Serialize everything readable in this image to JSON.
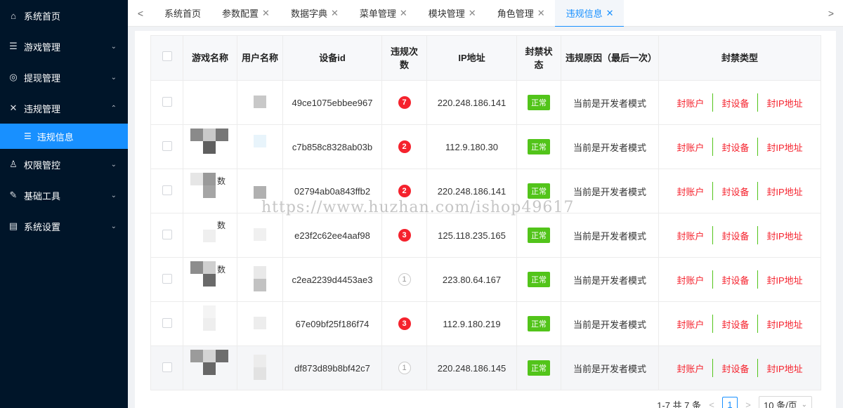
{
  "sidebar": {
    "items": [
      {
        "label": "系统首页",
        "icon": "home-icon",
        "glyph": "⌂",
        "has_children": false
      },
      {
        "label": "游戏管理",
        "icon": "list-icon",
        "glyph": "☰",
        "has_children": true,
        "chevron": "⌄"
      },
      {
        "label": "提现管理",
        "icon": "withdraw-icon",
        "glyph": "◎",
        "has_children": true,
        "chevron": "⌄"
      },
      {
        "label": "违规管理",
        "icon": "close-icon",
        "glyph": "✕",
        "has_children": true,
        "chevron": "⌃",
        "expanded": true
      },
      {
        "label": "权限管控",
        "icon": "user-icon",
        "glyph": "♙",
        "has_children": true,
        "chevron": "⌄"
      },
      {
        "label": "基础工具",
        "icon": "wrench-icon",
        "glyph": "✎",
        "has_children": true,
        "chevron": "⌄"
      },
      {
        "label": "系统设置",
        "icon": "settings-icon",
        "glyph": "▤",
        "has_children": true,
        "chevron": "⌄"
      }
    ],
    "sub_item": {
      "label": "违规信息",
      "icon": "list-icon",
      "glyph": "☰"
    }
  },
  "tabs": {
    "left_arrow": "<",
    "right_arrow": ">",
    "close_glyph": "✕",
    "items": [
      {
        "label": "系统首页",
        "closable": false
      },
      {
        "label": "参数配置",
        "closable": true
      },
      {
        "label": "数据字典",
        "closable": true
      },
      {
        "label": "菜单管理",
        "closable": true
      },
      {
        "label": "模块管理",
        "closable": true
      },
      {
        "label": "角色管理",
        "closable": true
      },
      {
        "label": "违规信息",
        "closable": true,
        "active": true
      }
    ]
  },
  "table": {
    "headers": {
      "game_name": "游戏名称",
      "username": "用户名称",
      "device_id": "设备id",
      "violation_count": "违规次数",
      "ip": "IP地址",
      "ban_status": "封禁状态",
      "reason": "违规原因（最后一次）",
      "ban_type": "封禁类型"
    },
    "rows": [
      {
        "device_id": "49ce1075ebbee967",
        "count": "7",
        "ip": "220.248.186.141",
        "status": "正常",
        "reason": "当前是开发者模式"
      },
      {
        "device_id": "c7b858c8328ab03b",
        "count": "2",
        "ip": "112.9.180.30",
        "status": "正常",
        "reason": "当前是开发者模式"
      },
      {
        "device_id": "02794ab0a843ffb2",
        "count": "2",
        "ip": "220.248.186.141",
        "status": "正常",
        "reason": "当前是开发者模式"
      },
      {
        "device_id": "e23f2c62ee4aaf98",
        "count": "3",
        "ip": "125.118.235.165",
        "status": "正常",
        "reason": "当前是开发者模式"
      },
      {
        "device_id": "c2ea2239d4453ae3",
        "count": "1",
        "ip": "223.80.64.167",
        "status": "正常",
        "reason": "当前是开发者模式"
      },
      {
        "device_id": "67e09bf25f186f74",
        "count": "3",
        "ip": "112.9.180.219",
        "status": "正常",
        "reason": "当前是开发者模式"
      },
      {
        "device_id": "df873d89b8bf42c7",
        "count": "1",
        "ip": "220.248.186.145",
        "status": "正常",
        "reason": "当前是开发者模式"
      }
    ],
    "actions": {
      "ban_account": "封账户",
      "ban_device": "封设备",
      "ban_ip": "封IP地址"
    },
    "name_fragment": "数"
  },
  "pagination": {
    "summary": "1-7 共 7 条",
    "prev": "<",
    "next": ">",
    "current_page": "1",
    "page_size": "10 条/页",
    "chevron": "⌄"
  },
  "watermark": "https://www.huzhan.com/ishop49617",
  "colors": {
    "accent": "#1890ff",
    "sidebar": "#001529",
    "danger": "#f5222d",
    "success": "#52c41a"
  }
}
